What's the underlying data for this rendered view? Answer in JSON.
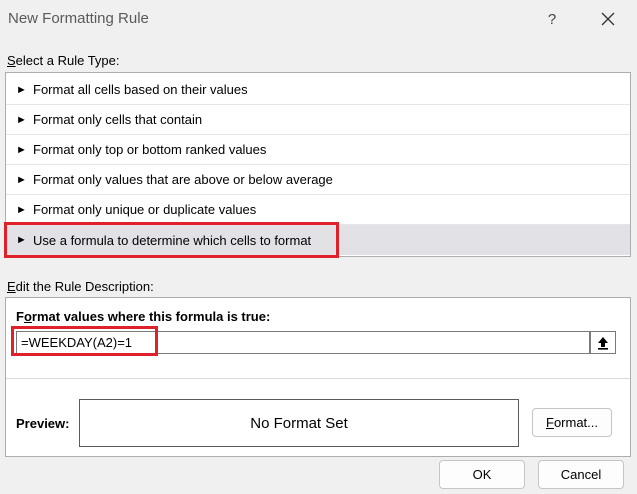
{
  "dialog": {
    "title": "New Formatting Rule",
    "help_label": "?"
  },
  "rule_type": {
    "label_accel": "S",
    "label_rest": "elect a Rule Type:",
    "arrow_glyph": "►",
    "items": [
      {
        "label": "Format all cells based on their values"
      },
      {
        "label": "Format only cells that contain"
      },
      {
        "label": "Format only top or bottom ranked values"
      },
      {
        "label": "Format only values that are above or below average"
      },
      {
        "label": "Format only unique or duplicate values"
      },
      {
        "label": "Use a formula to determine which cells to format"
      }
    ],
    "selected_index": 5
  },
  "description": {
    "label_accel": "E",
    "label_rest": "dit the Rule Description:",
    "formula_label_accel": "o",
    "formula_label_pre": "F",
    "formula_label_rest": "rmat values where this formula is true:",
    "formula_value": "=WEEKDAY(A2)=1",
    "preview_label": "Preview:",
    "preview_text": "No Format Set",
    "format_button_accel": "F",
    "format_button_rest": "ormat..."
  },
  "footer": {
    "ok_label": "OK",
    "cancel_label": "Cancel"
  },
  "colors": {
    "highlight": "#e0202b",
    "selected_row": "#e1e1e6"
  }
}
